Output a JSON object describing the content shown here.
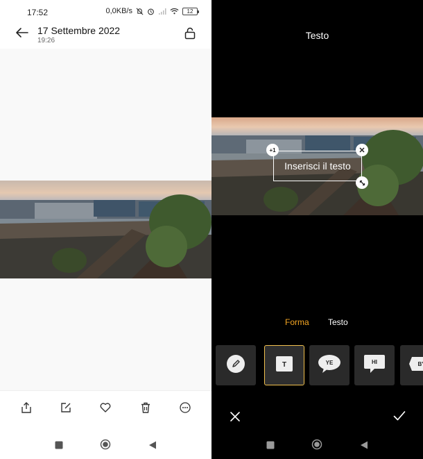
{
  "status_bar": {
    "time": "17:52",
    "net_speed": "0,0KB/s",
    "battery": "12"
  },
  "viewer": {
    "date_title": "17 Settembre 2022",
    "time_subtitle": "19:26"
  },
  "editor": {
    "title": "Testo",
    "text_placeholder": "Inserisci il testo",
    "handle_badge": "+1",
    "tabs": [
      {
        "label": "Forma",
        "active": true
      },
      {
        "label": "Testo",
        "active": false
      }
    ],
    "shapes": [
      {
        "icon": "pencil-icon"
      },
      {
        "icon": "text-box-icon",
        "label": "T",
        "selected": true
      },
      {
        "icon": "speech-bubble-icon",
        "label": "YE"
      },
      {
        "icon": "speech-bubble-square-icon",
        "label": "HI"
      },
      {
        "icon": "speech-bubble-tag-icon",
        "label": "BY"
      }
    ]
  },
  "colors": {
    "accent": "#f5a623",
    "selected_border": "#f2c14e"
  }
}
